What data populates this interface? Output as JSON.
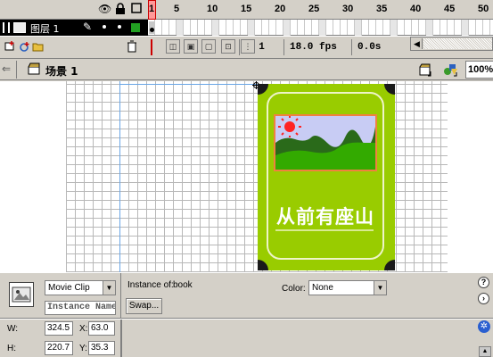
{
  "timeline": {
    "frame_numbers": [
      "1",
      "5",
      "10",
      "15",
      "20",
      "25",
      "30",
      "35",
      "40",
      "45",
      "50"
    ],
    "layer_name": "图层 1",
    "current_frame": "1",
    "frame_rate": "18.0 fps",
    "elapsed_time": "0.0s"
  },
  "edit_bar": {
    "scene_label": "场景 1",
    "zoom": "100%"
  },
  "book": {
    "title": "从前有座山",
    "colors": {
      "cover": "#99cc00",
      "sky": "#c8ccf4",
      "hill": "#33aa00",
      "sun": "#ff2222"
    }
  },
  "properties": {
    "symbol_type": "Movie Clip",
    "instance_name_placeholder": "Instance Name",
    "instance_of_label": "Instance of:",
    "instance_of_value": "book",
    "swap_label": "Swap...",
    "color_label": "Color:",
    "color_value": "None",
    "w_label": "W:",
    "w_value": "324.5",
    "h_label": "H:",
    "h_value": "220.7",
    "x_label": "X:",
    "x_value": "63.0",
    "y_label": "Y:",
    "y_value": "35.3"
  }
}
